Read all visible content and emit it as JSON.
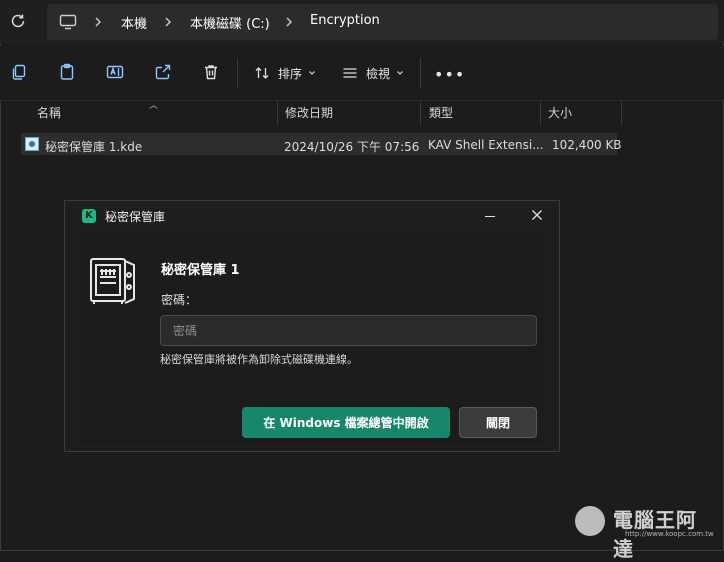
{
  "address_bar": {
    "breadcrumbs": [
      "本機",
      "本機磁碟 (C:)",
      "Encryption"
    ]
  },
  "toolbar": {
    "sort_label": "排序",
    "view_label": "檢視",
    "more_label": "•••"
  },
  "file_list": {
    "columns": [
      "名稱",
      "修改日期",
      "類型",
      "大小"
    ],
    "rows": [
      {
        "name": "秘密保管庫 1.kde",
        "modified": "2024/10/26 下午 07:56",
        "type": "KAV Shell Extensi...",
        "size": "102,400 KB"
      }
    ]
  },
  "dialog": {
    "title": "秘密保管庫",
    "vault_name": "秘密保管庫 1",
    "password_label": "密碼：",
    "password_placeholder": "密碼",
    "password_value": "",
    "note": "秘密保管庫將被作為卸除式磁碟機連線。",
    "open_button": "在 Windows 檔案總管中開啟",
    "close_button": "關閉",
    "logo_letter": "K",
    "brand_color": "#17876a"
  },
  "watermark": {
    "text": "電腦王阿達",
    "url": "http://www.koopc.com.tw"
  }
}
